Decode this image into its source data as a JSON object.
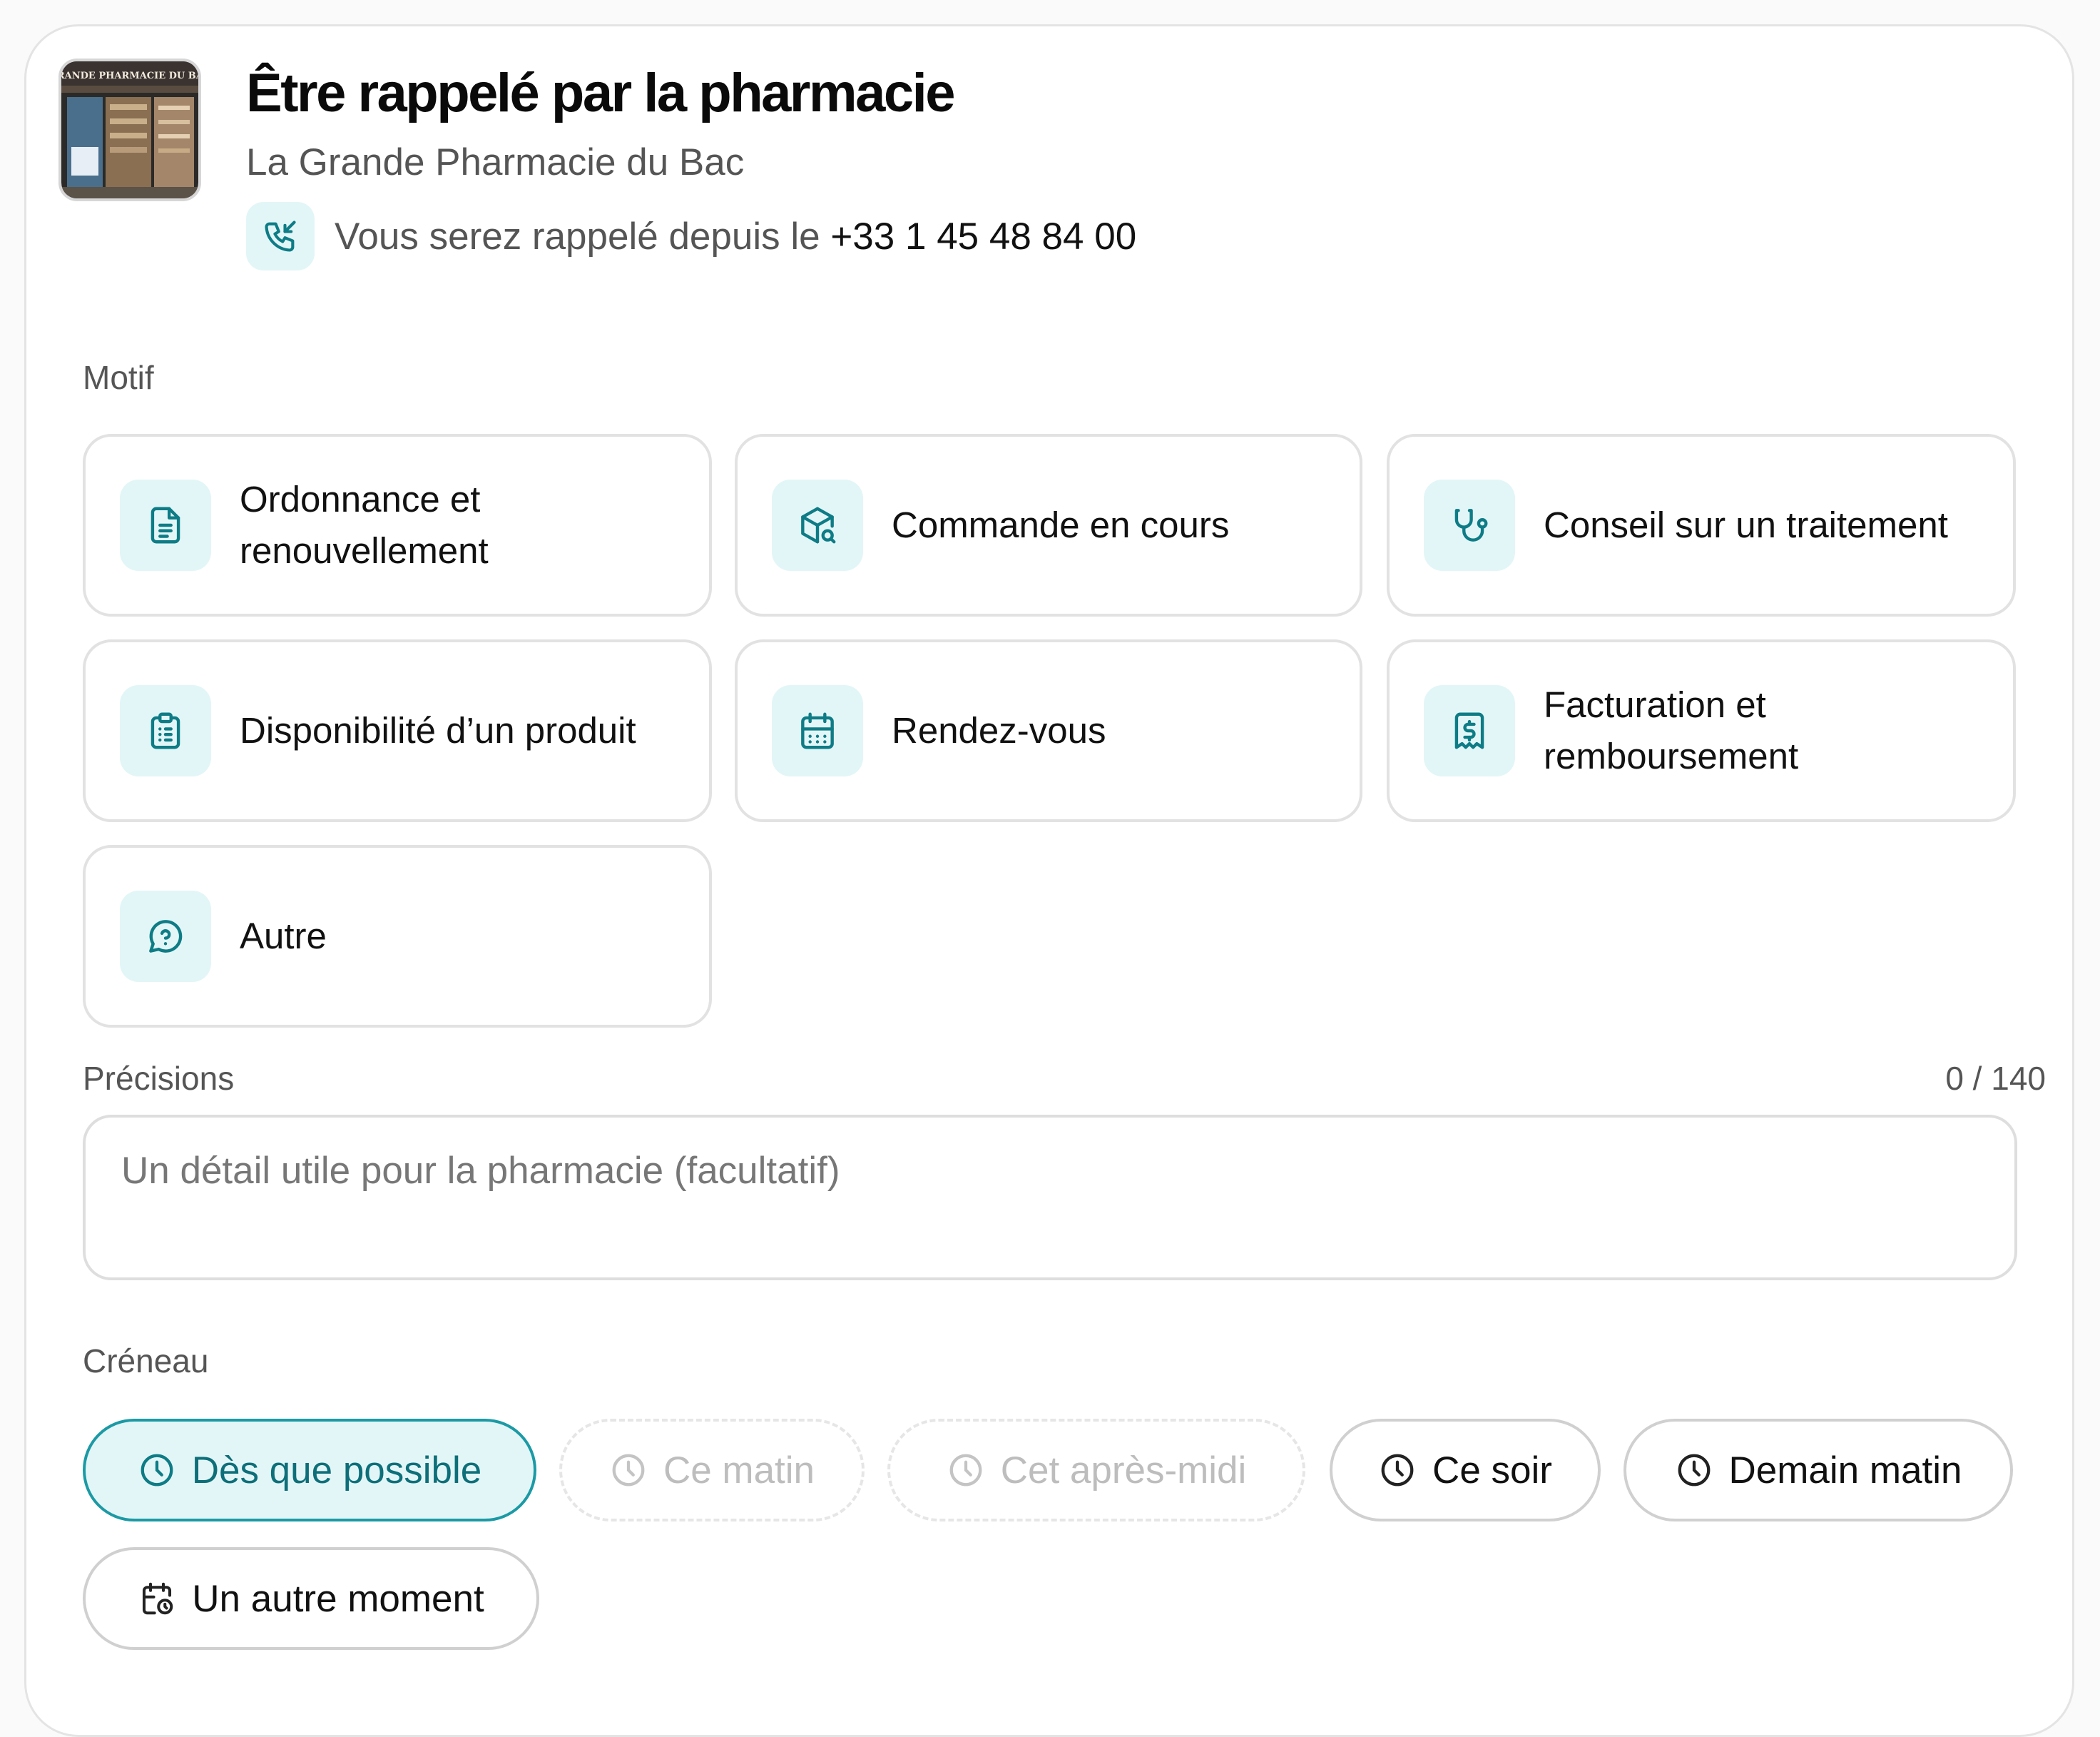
{
  "header": {
    "title": "Être rappelé par la pharmacie",
    "pharmacy_name": "La Grande Pharmacie du Bac",
    "callback_prefix": "Vous serez rappelé depuis le",
    "callback_number": "+33 1 45 48 84 00",
    "storefront_sign": "GRANDE PHARMACIE DU BAC"
  },
  "motif": {
    "label": "Motif",
    "options": [
      {
        "label": "Ordonnance et renouvellement",
        "icon": "document-icon"
      },
      {
        "label": "Commande en cours",
        "icon": "package-search-icon"
      },
      {
        "label": "Conseil sur un traitement",
        "icon": "stethoscope-icon"
      },
      {
        "label": "Disponibilité d’un produit",
        "icon": "clipboard-list-icon"
      },
      {
        "label": "Rendez-vous",
        "icon": "calendar-icon"
      },
      {
        "label": "Facturation et remboursement",
        "icon": "receipt-dollar-icon"
      },
      {
        "label": "Autre",
        "icon": "question-bubble-icon"
      }
    ]
  },
  "precisions": {
    "label": "Précisions",
    "counter": "0 / 140",
    "placeholder": "Un détail utile pour la pharmacie (facultatif)",
    "value": ""
  },
  "creneau": {
    "label": "Créneau",
    "slots": [
      {
        "label": "Dès que possible",
        "state": "selected",
        "icon": "clock-icon"
      },
      {
        "label": "Ce matin",
        "state": "disabled",
        "icon": "clock-icon"
      },
      {
        "label": "Cet après-midi",
        "state": "disabled",
        "icon": "clock-icon"
      },
      {
        "label": "Ce soir",
        "state": "default",
        "icon": "clock-icon"
      },
      {
        "label": "Demain matin",
        "state": "default",
        "icon": "clock-icon"
      },
      {
        "label": "Un autre moment",
        "state": "default",
        "icon": "calendar-clock-icon"
      }
    ]
  },
  "colors": {
    "accent": "#0e7c86",
    "accent_bg": "#e3f6f7",
    "selected_border": "#1b9aa5",
    "border": "#e2e2e2"
  }
}
